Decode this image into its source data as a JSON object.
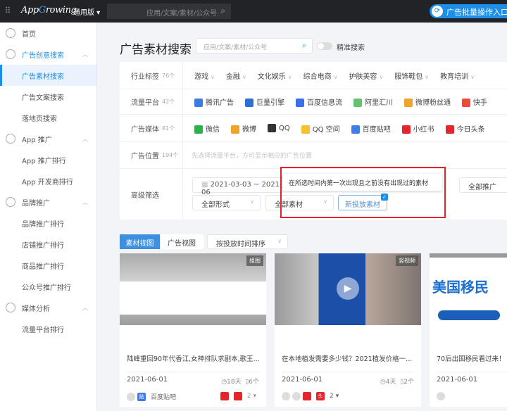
{
  "topbar": {
    "logo": "AppGrowing",
    "edition": "通用版",
    "search_placeholder": "应用/文案/素材/公众号",
    "batch_button": "广告批量操作入口"
  },
  "sidebar": {
    "items": [
      {
        "label": "首页",
        "type": "grp",
        "icon": "dashboard-icon"
      },
      {
        "label": "广告创意搜索",
        "type": "grp",
        "icon": "image-search-icon",
        "blue": true
      },
      {
        "label": "广告素材搜索",
        "type": "sub",
        "active": true
      },
      {
        "label": "广告文案搜索",
        "type": "sub"
      },
      {
        "label": "落地页搜索",
        "type": "sub"
      },
      {
        "label": "App 推广",
        "type": "grp",
        "icon": "apps-icon"
      },
      {
        "label": "App 推广排行",
        "type": "sub"
      },
      {
        "label": "App 开发商排行",
        "type": "sub"
      },
      {
        "label": "品牌推广",
        "type": "grp",
        "icon": "brand-icon"
      },
      {
        "label": "品牌推广排行",
        "type": "sub"
      },
      {
        "label": "店铺推广排行",
        "type": "sub"
      },
      {
        "label": "商品推广排行",
        "type": "sub"
      },
      {
        "label": "公众号推广排行",
        "type": "sub"
      },
      {
        "label": "媒体分析",
        "type": "grp",
        "icon": "media-icon"
      },
      {
        "label": "流量平台排行",
        "type": "sub"
      }
    ]
  },
  "page": {
    "title": "广告素材搜索",
    "search_placeholder": "应用/文案/素材/公众号",
    "precise_label": "精准搜索"
  },
  "filters": {
    "industry": {
      "label": "行业标签",
      "count": "76个",
      "options": [
        "游戏",
        "金融",
        "文化娱乐",
        "综合电商",
        "护肤美容",
        "服饰鞋包",
        "教育培训"
      ]
    },
    "platform": {
      "label": "流量平台",
      "count": "42个",
      "options": [
        {
          "name": "腾讯广告",
          "color": "#3b7de0"
        },
        {
          "name": "巨量引擎",
          "color": "#2c6fd6"
        },
        {
          "name": "百度信息流",
          "color": "#3a6fe8"
        },
        {
          "name": "阿里汇川",
          "color": "#67c26f"
        },
        {
          "name": "微博粉丝通",
          "color": "#f0a22b"
        },
        {
          "name": "快手",
          "color": "#e94d3c"
        }
      ]
    },
    "media": {
      "label": "广告媒体",
      "count": "81个",
      "options": [
        {
          "name": "微信",
          "color": "#2bb24c"
        },
        {
          "name": "微博",
          "color": "#f0a22b"
        },
        {
          "name": "QQ",
          "color": "#333333"
        },
        {
          "name": "QQ 空间",
          "color": "#f5c12e"
        },
        {
          "name": "百度贴吧",
          "color": "#3e7fe6"
        },
        {
          "name": "小红书",
          "color": "#e4252c"
        },
        {
          "name": "今日头条",
          "color": "#e4252c"
        }
      ]
    },
    "position": {
      "label": "广告位置",
      "count": "194个",
      "hint": "先选择流量平台，方可显示相应的广告位置"
    },
    "advanced": {
      "label": "高级筛选",
      "date_start": "2021-03-03",
      "date_sep": "~",
      "date_end": "2021-06",
      "promo": "全部推广",
      "form": "全部形式",
      "material": "全部素材",
      "new_button": "新投放素材",
      "tooltip": "在所选时间内第一次出现且之前没有出现过的素材"
    }
  },
  "view": {
    "tabs": [
      "素材视图",
      "广告视图"
    ],
    "sort": "按投放时间排序"
  },
  "cards": [
    {
      "badge": "组图",
      "title": "陆峰重回90年代香江,女神排队求剧本,歌王...",
      "date": "2021-06-01",
      "days": "18天",
      "count": "6个",
      "media": "百度贴吧",
      "more": "2"
    },
    {
      "badge": "竖视频",
      "title": "在本地植发需要多少钱？2021植发价格一...",
      "date": "2021-06-01",
      "days": "4天",
      "count": "2个",
      "more": "2"
    },
    {
      "title": "70后出国移民看过来！",
      "date": "2021-06-01",
      "image_text": "美国移民"
    }
  ],
  "accent": "#1c8fe8"
}
